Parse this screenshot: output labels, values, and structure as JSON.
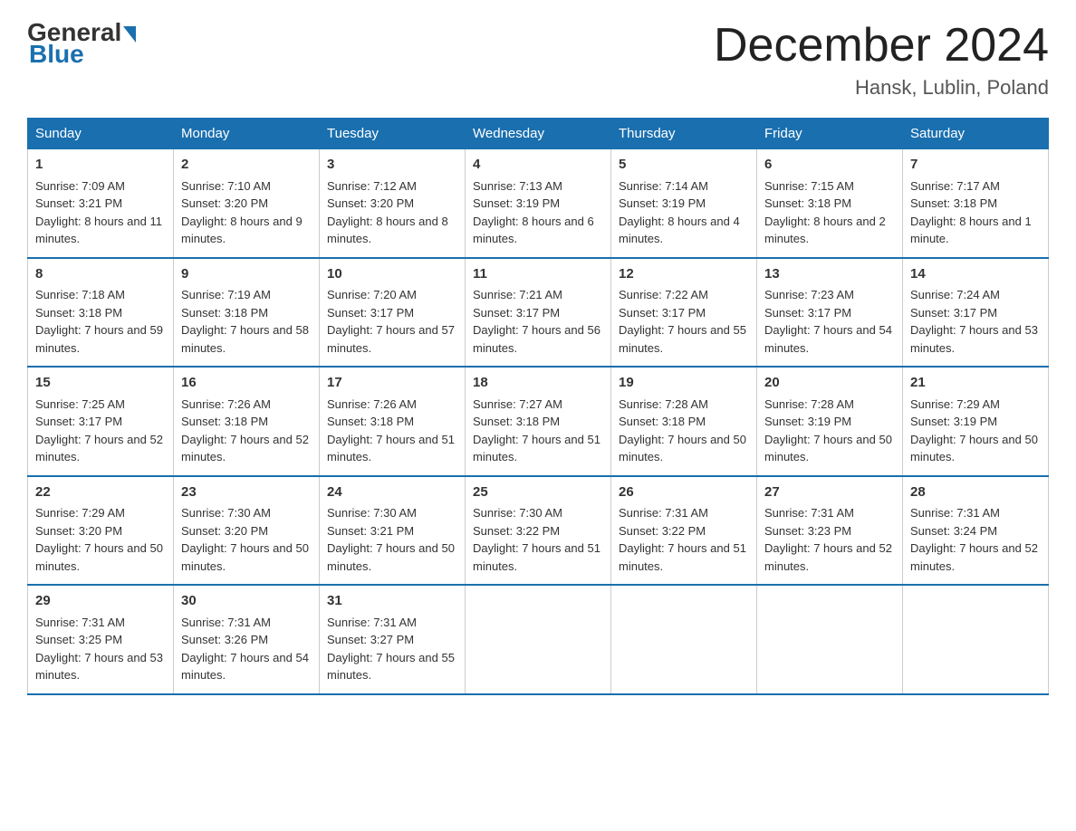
{
  "logo": {
    "general": "General",
    "blue": "Blue"
  },
  "title": "December 2024",
  "location": "Hansk, Lublin, Poland",
  "days_of_week": [
    "Sunday",
    "Monday",
    "Tuesday",
    "Wednesday",
    "Thursday",
    "Friday",
    "Saturday"
  ],
  "weeks": [
    [
      {
        "day": "1",
        "sunrise": "7:09 AM",
        "sunset": "3:21 PM",
        "daylight": "8 hours and 11 minutes."
      },
      {
        "day": "2",
        "sunrise": "7:10 AM",
        "sunset": "3:20 PM",
        "daylight": "8 hours and 9 minutes."
      },
      {
        "day": "3",
        "sunrise": "7:12 AM",
        "sunset": "3:20 PM",
        "daylight": "8 hours and 8 minutes."
      },
      {
        "day": "4",
        "sunrise": "7:13 AM",
        "sunset": "3:19 PM",
        "daylight": "8 hours and 6 minutes."
      },
      {
        "day": "5",
        "sunrise": "7:14 AM",
        "sunset": "3:19 PM",
        "daylight": "8 hours and 4 minutes."
      },
      {
        "day": "6",
        "sunrise": "7:15 AM",
        "sunset": "3:18 PM",
        "daylight": "8 hours and 2 minutes."
      },
      {
        "day": "7",
        "sunrise": "7:17 AM",
        "sunset": "3:18 PM",
        "daylight": "8 hours and 1 minute."
      }
    ],
    [
      {
        "day": "8",
        "sunrise": "7:18 AM",
        "sunset": "3:18 PM",
        "daylight": "7 hours and 59 minutes."
      },
      {
        "day": "9",
        "sunrise": "7:19 AM",
        "sunset": "3:18 PM",
        "daylight": "7 hours and 58 minutes."
      },
      {
        "day": "10",
        "sunrise": "7:20 AM",
        "sunset": "3:17 PM",
        "daylight": "7 hours and 57 minutes."
      },
      {
        "day": "11",
        "sunrise": "7:21 AM",
        "sunset": "3:17 PM",
        "daylight": "7 hours and 56 minutes."
      },
      {
        "day": "12",
        "sunrise": "7:22 AM",
        "sunset": "3:17 PM",
        "daylight": "7 hours and 55 minutes."
      },
      {
        "day": "13",
        "sunrise": "7:23 AM",
        "sunset": "3:17 PM",
        "daylight": "7 hours and 54 minutes."
      },
      {
        "day": "14",
        "sunrise": "7:24 AM",
        "sunset": "3:17 PM",
        "daylight": "7 hours and 53 minutes."
      }
    ],
    [
      {
        "day": "15",
        "sunrise": "7:25 AM",
        "sunset": "3:17 PM",
        "daylight": "7 hours and 52 minutes."
      },
      {
        "day": "16",
        "sunrise": "7:26 AM",
        "sunset": "3:18 PM",
        "daylight": "7 hours and 52 minutes."
      },
      {
        "day": "17",
        "sunrise": "7:26 AM",
        "sunset": "3:18 PM",
        "daylight": "7 hours and 51 minutes."
      },
      {
        "day": "18",
        "sunrise": "7:27 AM",
        "sunset": "3:18 PM",
        "daylight": "7 hours and 51 minutes."
      },
      {
        "day": "19",
        "sunrise": "7:28 AM",
        "sunset": "3:18 PM",
        "daylight": "7 hours and 50 minutes."
      },
      {
        "day": "20",
        "sunrise": "7:28 AM",
        "sunset": "3:19 PM",
        "daylight": "7 hours and 50 minutes."
      },
      {
        "day": "21",
        "sunrise": "7:29 AM",
        "sunset": "3:19 PM",
        "daylight": "7 hours and 50 minutes."
      }
    ],
    [
      {
        "day": "22",
        "sunrise": "7:29 AM",
        "sunset": "3:20 PM",
        "daylight": "7 hours and 50 minutes."
      },
      {
        "day": "23",
        "sunrise": "7:30 AM",
        "sunset": "3:20 PM",
        "daylight": "7 hours and 50 minutes."
      },
      {
        "day": "24",
        "sunrise": "7:30 AM",
        "sunset": "3:21 PM",
        "daylight": "7 hours and 50 minutes."
      },
      {
        "day": "25",
        "sunrise": "7:30 AM",
        "sunset": "3:22 PM",
        "daylight": "7 hours and 51 minutes."
      },
      {
        "day": "26",
        "sunrise": "7:31 AM",
        "sunset": "3:22 PM",
        "daylight": "7 hours and 51 minutes."
      },
      {
        "day": "27",
        "sunrise": "7:31 AM",
        "sunset": "3:23 PM",
        "daylight": "7 hours and 52 minutes."
      },
      {
        "day": "28",
        "sunrise": "7:31 AM",
        "sunset": "3:24 PM",
        "daylight": "7 hours and 52 minutes."
      }
    ],
    [
      {
        "day": "29",
        "sunrise": "7:31 AM",
        "sunset": "3:25 PM",
        "daylight": "7 hours and 53 minutes."
      },
      {
        "day": "30",
        "sunrise": "7:31 AM",
        "sunset": "3:26 PM",
        "daylight": "7 hours and 54 minutes."
      },
      {
        "day": "31",
        "sunrise": "7:31 AM",
        "sunset": "3:27 PM",
        "daylight": "7 hours and 55 minutes."
      },
      null,
      null,
      null,
      null
    ]
  ],
  "labels": {
    "sunrise": "Sunrise:",
    "sunset": "Sunset:",
    "daylight": "Daylight:"
  }
}
